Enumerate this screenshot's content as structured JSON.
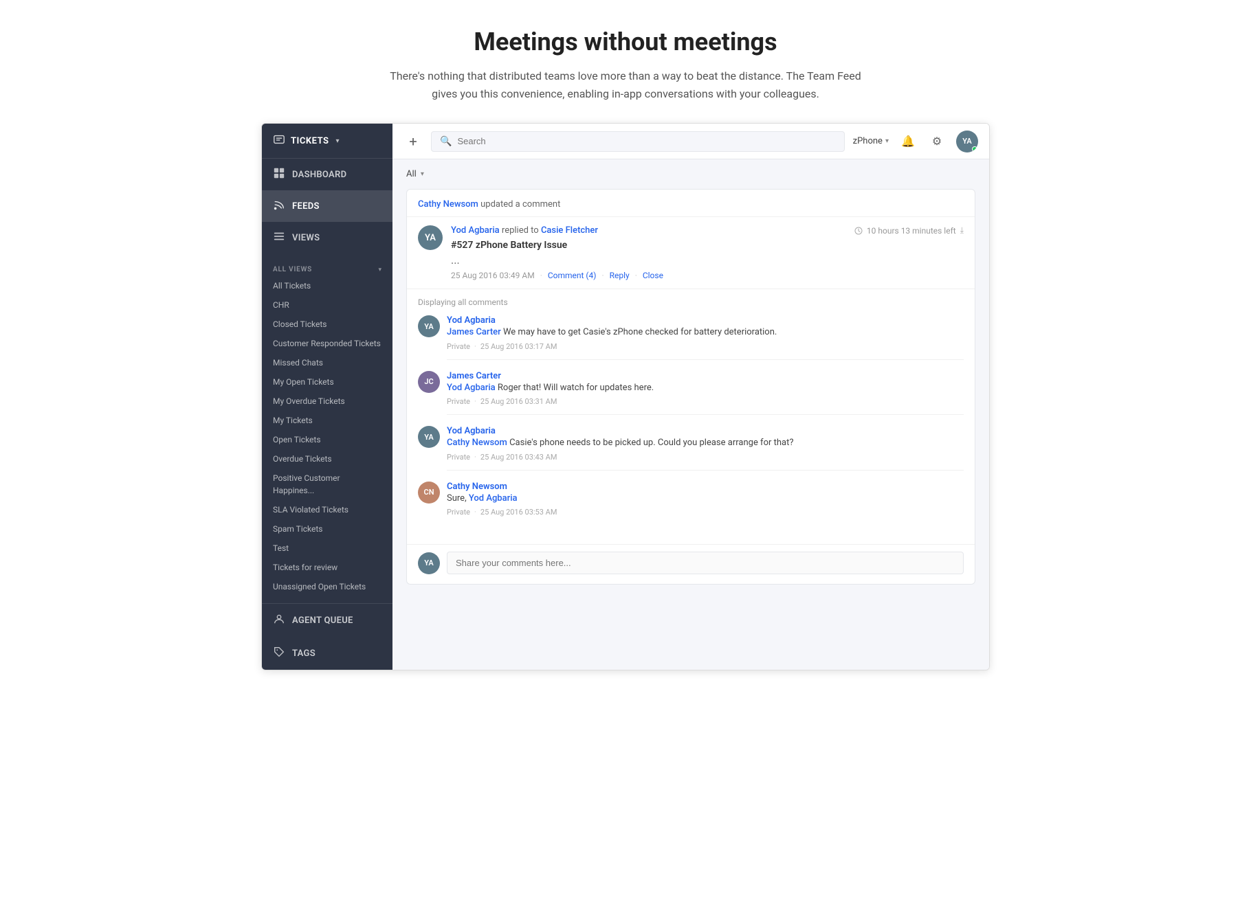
{
  "hero": {
    "title": "Meetings without meetings",
    "description": "There's nothing that distributed teams love more than a way to beat the distance. The Team Feed gives you this convenience, enabling in-app conversations with your colleagues."
  },
  "sidebar": {
    "tickets_label": "TICKETS",
    "dashboard_label": "DASHBOARD",
    "feeds_label": "FEEDS",
    "views_label": "VIEWS",
    "all_views_label": "ALL VIEWS",
    "agent_queue_label": "AGENT QUEUE",
    "tags_label": "TAGS",
    "view_items": [
      "All Tickets",
      "CHR",
      "Closed Tickets",
      "Customer Responded Tickets",
      "Missed Chats",
      "My Open Tickets",
      "My Overdue Tickets",
      "My Tickets",
      "Open Tickets",
      "Overdue Tickets",
      "Positive Customer Happines...",
      "SLA Violated Tickets",
      "Spam Tickets",
      "Test",
      "Tickets for review",
      "Unassigned Open Tickets"
    ]
  },
  "topbar": {
    "add_label": "+",
    "search_placeholder": "Search",
    "phone_label": "zPhone",
    "filter_label": "All"
  },
  "feed": {
    "updated_by": "Cathy Newsom",
    "updated_action": "updated a comment",
    "ticket_user_from": "Yod Agbaria",
    "ticket_replied_to": "Casie Fletcher",
    "ticket_time": "10 hours 13 minutes left",
    "ticket_number": "#527",
    "ticket_title": "zPhone Battery Issue",
    "ticket_dots": "...",
    "ticket_date": "25 Aug 2016 03:49 AM",
    "ticket_comment_count": "Comment (4)",
    "ticket_reply_label": "Reply",
    "ticket_close_label": "Close",
    "displaying_label": "Displaying all comments",
    "comments": [
      {
        "author": "Yod Agbaria",
        "mention": "James Carter",
        "text": " We may have to get Casie's zPhone checked for battery deterioration.",
        "privacy": "Private",
        "date": "25 Aug 2016 03:17 AM",
        "avatar_bg": "#5d7b8a",
        "initials": "YA"
      },
      {
        "author": "James Carter",
        "mention": "Yod Agbaria",
        "text": " Roger that! Will watch for updates here.",
        "privacy": "Private",
        "date": "25 Aug 2016 03:31 AM",
        "avatar_bg": "#7a6b9a",
        "initials": "JC"
      },
      {
        "author": "Yod Agbaria",
        "mention": "Cathy Newsom",
        "text": " Casie's phone needs to be picked up. Could you please arrange for that?",
        "privacy": "Private",
        "date": "25 Aug 2016 03:43 AM",
        "avatar_bg": "#5d7b8a",
        "initials": "YA"
      },
      {
        "author": "Cathy Newsom",
        "mention": "Yod Agbaria",
        "text_prefix": "Sure, ",
        "text": "",
        "privacy": "Private",
        "date": "25 Aug 2016 03:53 AM",
        "avatar_bg": "#c0856a",
        "initials": "CN"
      }
    ],
    "reply_placeholder": "Share your comments here...",
    "reply_avatar_bg": "#5d7b8a",
    "reply_initials": "YA"
  }
}
